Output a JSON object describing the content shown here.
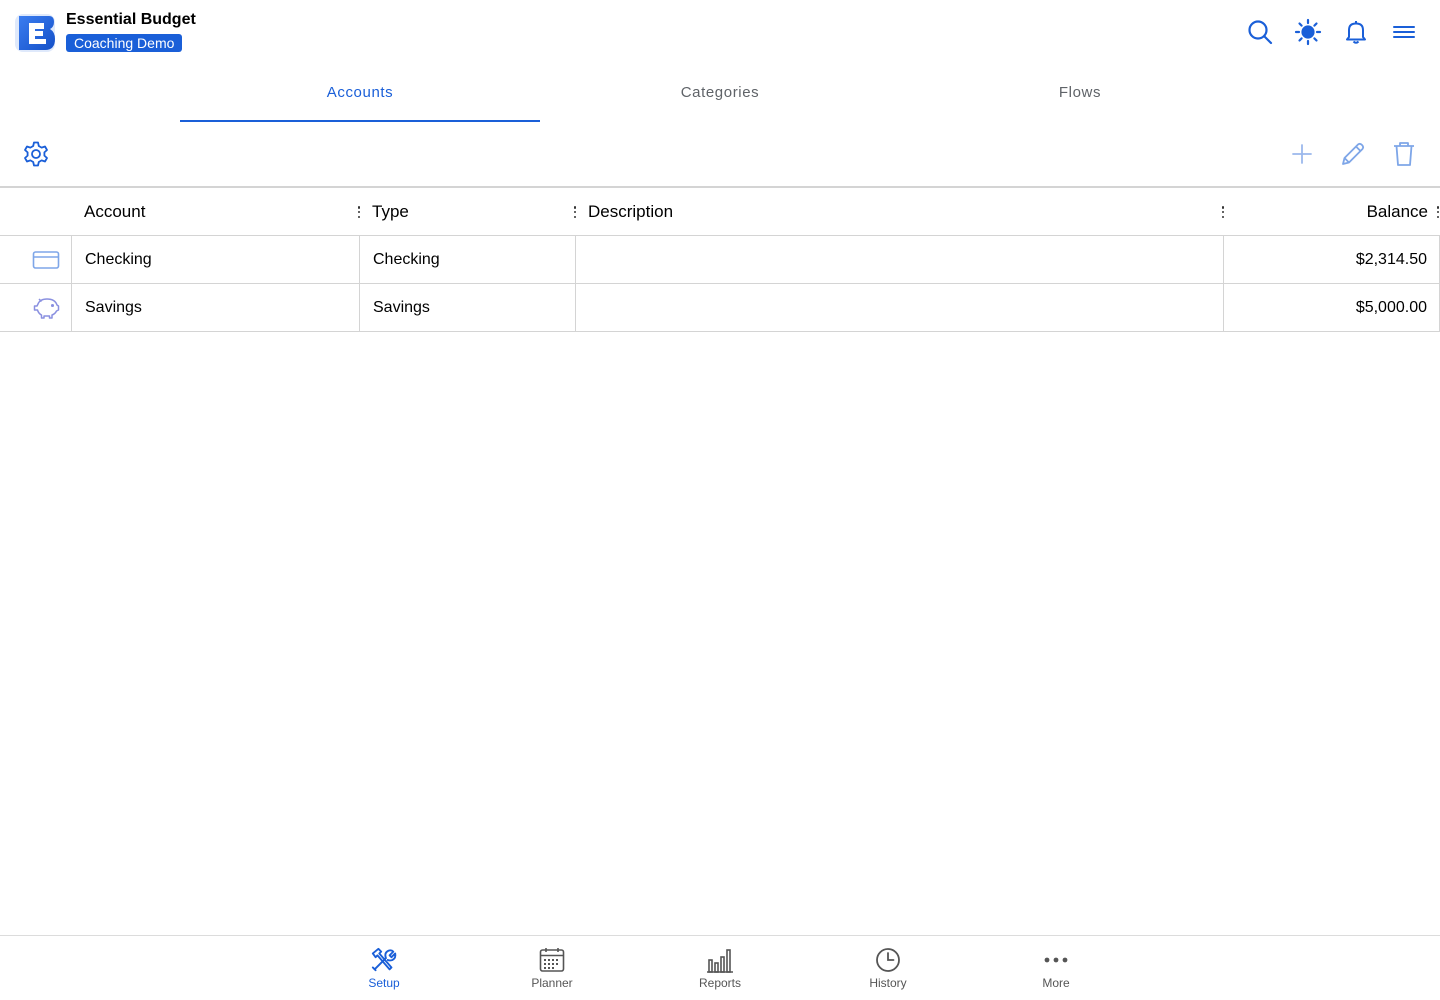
{
  "app": {
    "title": "Essential Budget",
    "badge": "Coaching Demo",
    "logo_letter": "E"
  },
  "header_icons": [
    "search-icon",
    "brightness-icon",
    "bell-icon",
    "menu-icon"
  ],
  "tabs": [
    {
      "label": "Accounts",
      "active": true
    },
    {
      "label": "Categories",
      "active": false
    },
    {
      "label": "Flows",
      "active": false
    }
  ],
  "toolbar": {
    "settings_icon": "gear-icon",
    "actions": [
      "plus-icon",
      "pencil-icon",
      "trash-icon"
    ]
  },
  "table": {
    "columns": [
      "Account",
      "Type",
      "Description",
      "Balance"
    ],
    "rows": [
      {
        "icon": "credit-card-icon",
        "account": "Checking",
        "type": "Checking",
        "description": "",
        "balance": "$2,314.50"
      },
      {
        "icon": "piggy-bank-icon",
        "account": "Savings",
        "type": "Savings",
        "description": "",
        "balance": "$5,000.00"
      }
    ]
  },
  "bottom_nav": [
    {
      "label": "Setup",
      "icon": "tools-icon",
      "active": true
    },
    {
      "label": "Planner",
      "icon": "calendar-icon",
      "active": false
    },
    {
      "label": "Reports",
      "icon": "bar-chart-icon",
      "active": false
    },
    {
      "label": "History",
      "icon": "clock-icon",
      "active": false
    },
    {
      "label": "More",
      "icon": "more-icon",
      "active": false
    }
  ],
  "colors": {
    "accent": "#1a5fd8",
    "light_accent": "#7ea6e8",
    "border": "#d4d4d4"
  }
}
